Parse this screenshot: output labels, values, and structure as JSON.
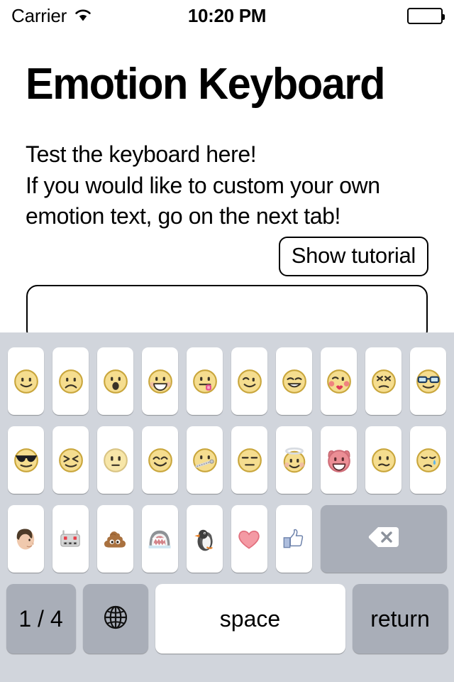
{
  "status_bar": {
    "carrier": "Carrier",
    "wifi_icon": "wifi-icon",
    "time": "10:20 PM",
    "battery_icon": "battery-icon"
  },
  "app": {
    "title": "Emotion Keyboard",
    "description": "Test the keyboard here!\nIf you would like to custom your own emotion text, go on the next tab!",
    "tutorial_button": "Show tutorial",
    "textfield": {
      "value": "",
      "placeholder": ""
    }
  },
  "keyboard": {
    "background_color": "#d1d5dc",
    "key_color": "#ffffff",
    "special_key_color": "#a9aeb8",
    "rows": [
      [
        {
          "name": "key-slight-smile",
          "icon": "slight-smiling-face"
        },
        {
          "name": "key-frowning",
          "icon": "frowning-face"
        },
        {
          "name": "key-open-mouth",
          "icon": "face-with-open-mouth"
        },
        {
          "name": "key-grinning",
          "icon": "grinning-face"
        },
        {
          "name": "key-tongue-out",
          "icon": "face-with-tongue"
        },
        {
          "name": "key-winking",
          "icon": "winking-face"
        },
        {
          "name": "key-sweat-smile",
          "icon": "smiling-face-with-sweat"
        },
        {
          "name": "key-kissing-heart",
          "icon": "face-blowing-a-kiss"
        },
        {
          "name": "key-persevering",
          "icon": "persevering-face"
        },
        {
          "name": "key-nerd",
          "icon": "nerd-face"
        }
      ],
      [
        {
          "name": "key-sunglasses",
          "icon": "smiling-face-with-sunglasses"
        },
        {
          "name": "key-laughing-squint",
          "icon": "squinting-face"
        },
        {
          "name": "key-neutral",
          "icon": "neutral-face"
        },
        {
          "name": "key-blush-smile",
          "icon": "smiling-face-with-smiling-eyes"
        },
        {
          "name": "key-zipper-mouth",
          "icon": "zipper-mouth-face"
        },
        {
          "name": "key-expressionless",
          "icon": "expressionless-face"
        },
        {
          "name": "key-halo",
          "icon": "smiling-face-with-halo"
        },
        {
          "name": "key-devil",
          "icon": "smiling-face-with-horns"
        },
        {
          "name": "key-confused",
          "icon": "confused-face"
        },
        {
          "name": "key-crying",
          "icon": "crying-face"
        }
      ],
      [
        {
          "name": "key-face-photo",
          "icon": "person-profile-photo"
        },
        {
          "name": "key-robot",
          "icon": "robot-face"
        },
        {
          "name": "key-poop",
          "icon": "pile-of-poo"
        },
        {
          "name": "key-shark",
          "icon": "shark-jaws"
        },
        {
          "name": "key-penguin",
          "icon": "penguin"
        },
        {
          "name": "key-heart",
          "icon": "red-heart"
        },
        {
          "name": "key-thumbs-up",
          "icon": "facebook-like-thumbs-up"
        }
      ]
    ],
    "backspace": {
      "name": "key-backspace",
      "icon": "delete-left-icon"
    },
    "bottom_row": {
      "page_indicator": "1 / 4",
      "globe_icon": "globe-icon",
      "space_label": "space",
      "return_label": "return"
    }
  }
}
